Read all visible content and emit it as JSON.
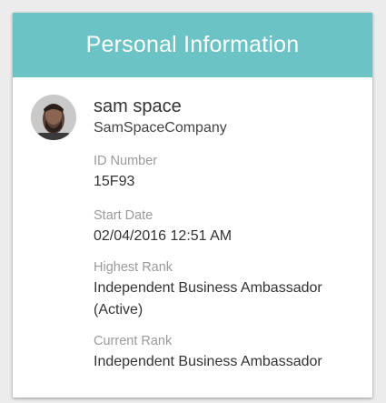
{
  "card": {
    "title": "Personal Information"
  },
  "profile": {
    "avatar_icon": "user-avatar-photo",
    "name": "sam space",
    "company": "SamSpaceCompany"
  },
  "fields": [
    {
      "label": "ID Number",
      "value": "15F93"
    },
    {
      "label": "Start Date",
      "value": "02/04/2016 12:51 AM"
    },
    {
      "label": "Highest Rank",
      "value": "Independent Business Ambassador (Active)"
    },
    {
      "label": "Current Rank",
      "value": "Independent Business Ambassador"
    }
  ],
  "colors": {
    "header": "#6cc3c5",
    "background": "#ececec",
    "label": "#9a9a9a",
    "text": "#333333"
  }
}
